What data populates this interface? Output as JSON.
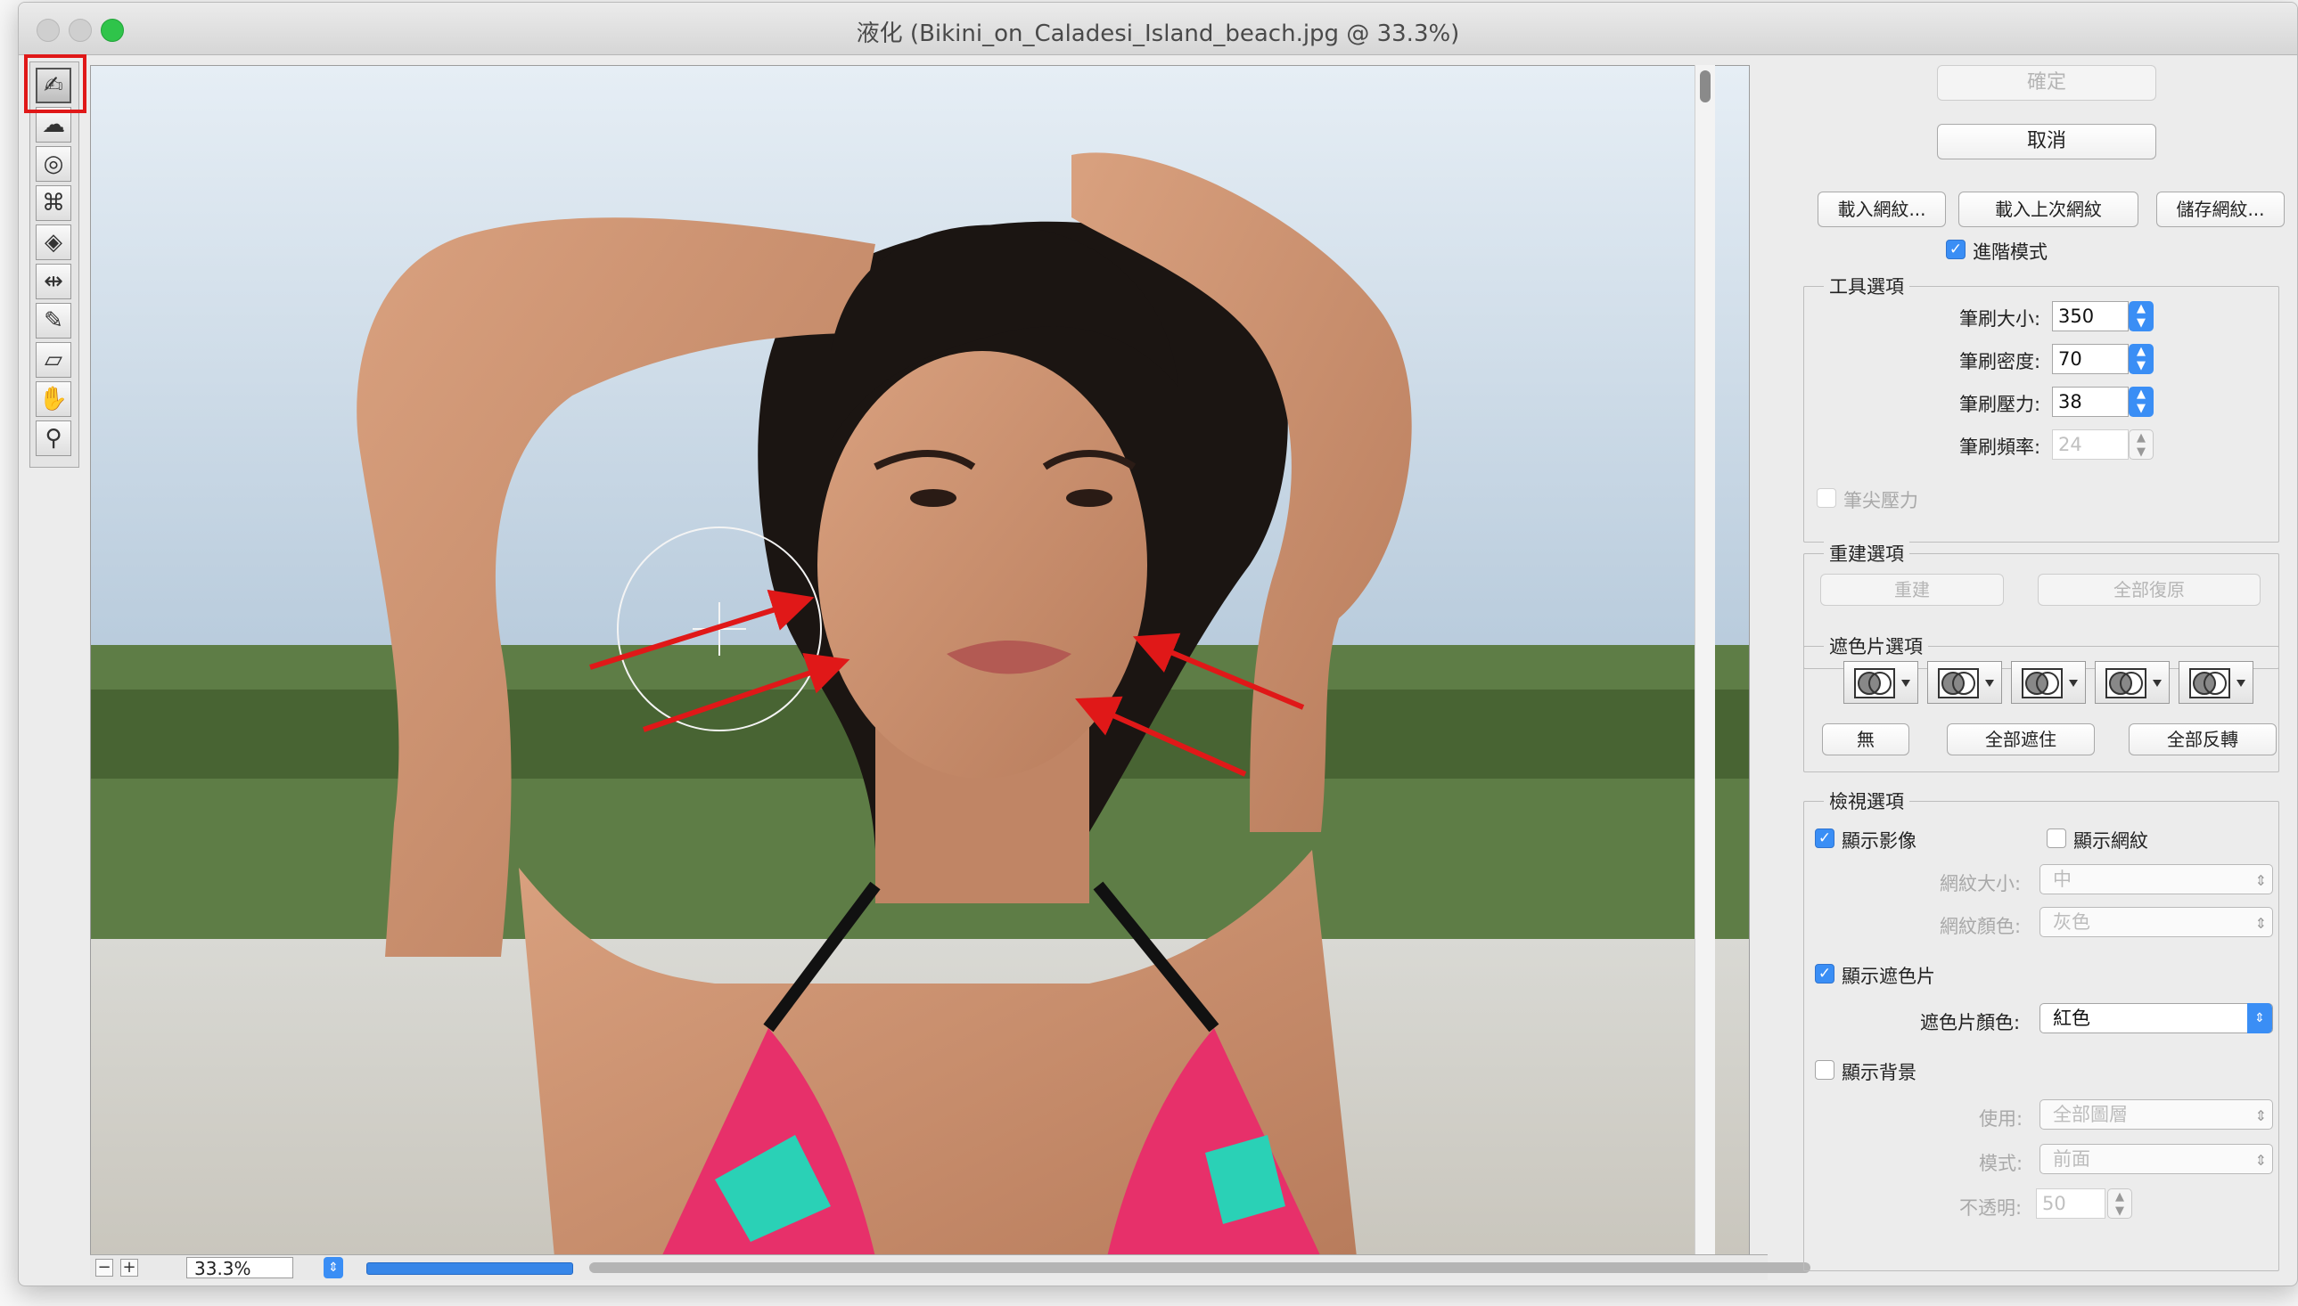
{
  "window": {
    "title": "液化 (Bikini_on_Caladesi_Island_beach.jpg @ 33.3%)"
  },
  "tools": [
    {
      "name": "forward-warp-tool-icon",
      "glyph": "✍"
    },
    {
      "name": "reconstruct-tool-icon",
      "glyph": "☁"
    },
    {
      "name": "twirl-clockwise-tool-icon",
      "glyph": "◎"
    },
    {
      "name": "pucker-tool-icon",
      "glyph": "⌘"
    },
    {
      "name": "bloat-tool-icon",
      "glyph": "◈"
    },
    {
      "name": "push-left-tool-icon",
      "glyph": "⇹"
    },
    {
      "name": "freeze-mask-tool-icon",
      "glyph": "✎"
    },
    {
      "name": "thaw-mask-tool-icon",
      "glyph": "▱"
    },
    {
      "name": "hand-tool-icon",
      "glyph": "✋"
    },
    {
      "name": "zoom-tool-icon",
      "glyph": "⚲"
    }
  ],
  "statusbar": {
    "zoom": "33.3%",
    "minus": "−",
    "plus": "+"
  },
  "buttons": {
    "ok": "確定",
    "cancel": "取消",
    "load_mesh": "載入網紋...",
    "load_last_mesh": "載入上次網紋",
    "save_mesh": "儲存網紋..."
  },
  "advanced_mode": {
    "label": "進階模式",
    "checked": true
  },
  "tool_options": {
    "title": "工具選項",
    "brush_size_label": "筆刷大小:",
    "brush_size": "350",
    "brush_density_label": "筆刷密度:",
    "brush_density": "70",
    "brush_pressure_label": "筆刷壓力:",
    "brush_pressure": "38",
    "brush_rate_label": "筆刷頻率:",
    "brush_rate": "24",
    "stylus_pressure": "筆尖壓力"
  },
  "reconstruct_options": {
    "title": "重建選項",
    "reconstruct": "重建",
    "restore_all": "全部復原"
  },
  "mask_options": {
    "title": "遮色片選項",
    "none": "無",
    "mask_all": "全部遮住",
    "invert_all": "全部反轉"
  },
  "view_options": {
    "title": "檢視選項",
    "show_image": "顯示影像",
    "show_mesh": "顯示網紋",
    "mesh_size_label": "網紋大小:",
    "mesh_size": "中",
    "mesh_color_label": "網紋顏色:",
    "mesh_color": "灰色",
    "show_mask": "顯示遮色片",
    "mask_color_label": "遮色片顏色:",
    "mask_color": "紅色",
    "show_backdrop": "顯示背景",
    "use_label": "使用:",
    "use": "全部圖層",
    "mode_label": "模式:",
    "mode": "前面",
    "opacity_label": "不透明:",
    "opacity": "50"
  },
  "colors": {
    "accent": "#3a8ef5",
    "annotation": "#e01818"
  }
}
